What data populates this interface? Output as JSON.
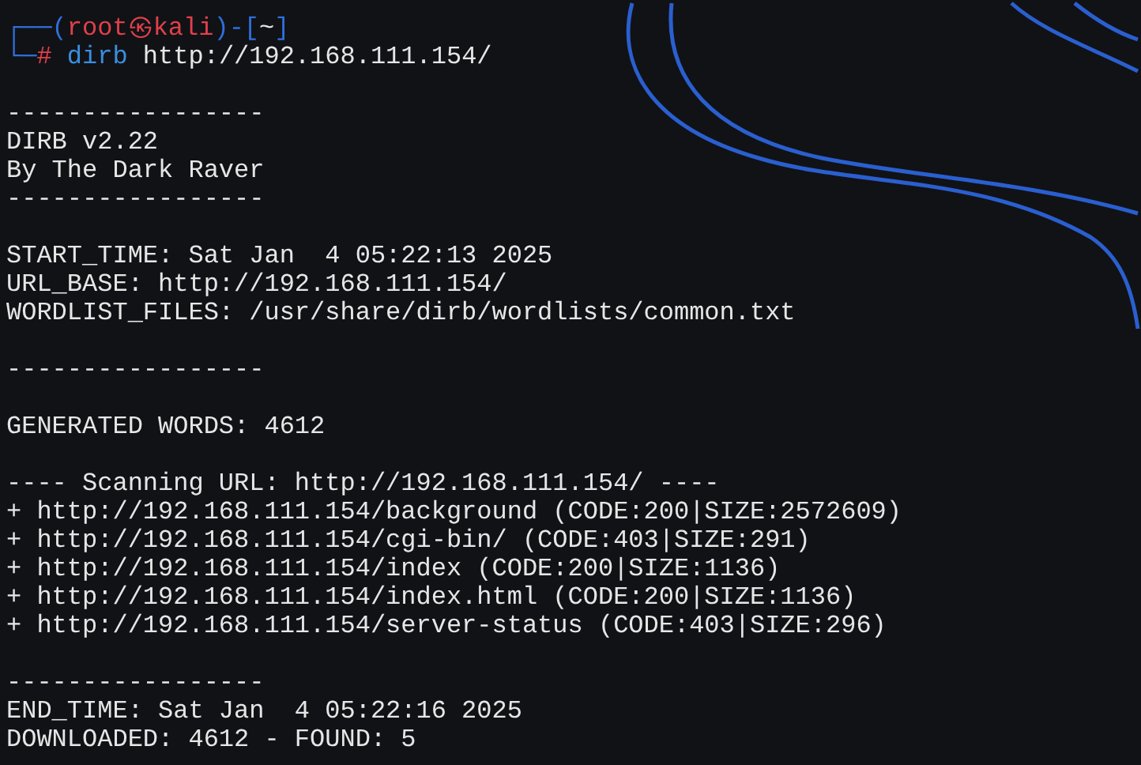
{
  "prompt": [
    {
      "segments": [
        {
          "text": "┌──(",
          "color": "#2f6fdc"
        },
        {
          "text": "root㉿kali",
          "color": "#e0404a"
        },
        {
          "text": ")-[",
          "color": "#2f6fdc"
        },
        {
          "text": "~",
          "color": "#e6e6e6"
        },
        {
          "text": "]",
          "color": "#2f6fdc"
        }
      ]
    },
    {
      "segments": [
        {
          "text": "└─",
          "color": "#2f6fdc"
        },
        {
          "text": "#",
          "color": "#e0404a"
        },
        {
          "text": " dirb",
          "color": "#3b8ee0"
        },
        {
          "text": " http://192.168.111.154/",
          "color": "#e6e6e6"
        }
      ]
    }
  ],
  "output": [
    {
      "kind": "blank"
    },
    {
      "kind": "text",
      "text": "-----------------"
    },
    {
      "kind": "text",
      "text": "DIRB v2.22"
    },
    {
      "kind": "text",
      "text": "By The Dark Raver"
    },
    {
      "kind": "text",
      "text": "-----------------"
    },
    {
      "kind": "blank"
    },
    {
      "kind": "text",
      "text": "START_TIME: Sat Jan  4 05:22:13 2025"
    },
    {
      "kind": "text",
      "text": "URL_BASE: http://192.168.111.154/"
    },
    {
      "kind": "text",
      "text": "WORDLIST_FILES: /usr/share/dirb/wordlists/common.txt"
    },
    {
      "kind": "blank"
    },
    {
      "kind": "text",
      "text": "-----------------"
    },
    {
      "kind": "blank"
    },
    {
      "kind": "text",
      "text": "GENERATED WORDS: 4612"
    },
    {
      "kind": "blank"
    },
    {
      "kind": "text",
      "text": "---- Scanning URL: http://192.168.111.154/ ----"
    },
    {
      "kind": "text",
      "text": "+ http://192.168.111.154/background (CODE:200|SIZE:2572609)"
    },
    {
      "kind": "text",
      "text": "+ http://192.168.111.154/cgi-bin/ (CODE:403|SIZE:291)"
    },
    {
      "kind": "text",
      "text": "+ http://192.168.111.154/index (CODE:200|SIZE:1136)"
    },
    {
      "kind": "text",
      "text": "+ http://192.168.111.154/index.html (CODE:200|SIZE:1136)"
    },
    {
      "kind": "text",
      "text": "+ http://192.168.111.154/server-status (CODE:403|SIZE:296)"
    },
    {
      "kind": "blank"
    },
    {
      "kind": "text",
      "text": "-----------------"
    },
    {
      "kind": "text",
      "text": "END_TIME: Sat Jan  4 05:22:16 2025"
    },
    {
      "kind": "text",
      "text": "DOWNLOADED: 4612 - FOUND: 5"
    }
  ]
}
